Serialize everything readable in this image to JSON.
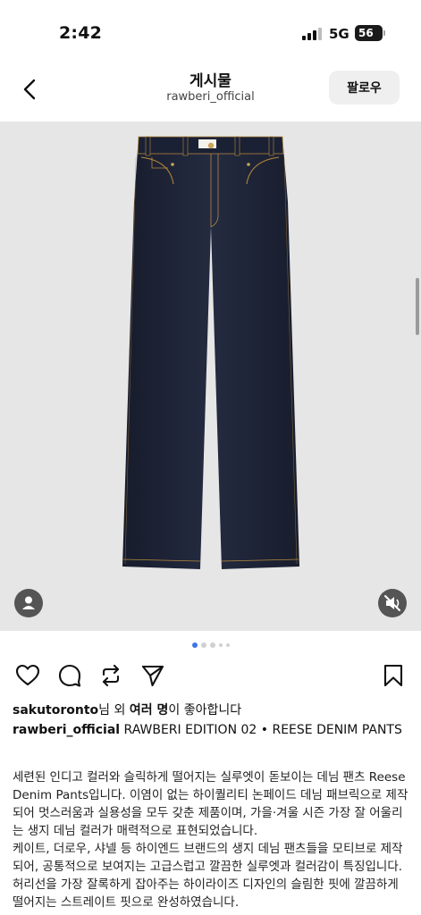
{
  "status_bar": {
    "time": "2:42",
    "network": "5G",
    "battery_label": "56"
  },
  "header": {
    "title": "게시물",
    "subtitle": "rawberi_official",
    "follow_label": "팔로우"
  },
  "post": {
    "image_subject": "dark indigo denim pants",
    "carousel": {
      "total": 5,
      "active_index": 0
    }
  },
  "likes": {
    "user": "sakutoronto",
    "mid": "님 외 ",
    "others": "여러 명",
    "suffix": "이 좋아합니다"
  },
  "caption": {
    "username": "rawberi_official",
    "headline": "RAWBERI EDITION 02 • REESE DENIM PANTS",
    "paragraph1": "세련된 인디고 컬러와 슬릭하게 떨어지는 실루엣이 돋보이는 데님 팬츠 Reese Denim Pants입니다. 이염이 없는 하이퀄리티 논페이드 데님 패브릭으로 제작되어 멋스러움과 실용성을 모두 갖춘 제품이며, 가을·겨울 시즌 가장 잘 어울리는 생지 데님 컬러가 매력적으로 표현되었습니다.",
    "paragraph2": "케이트, 더로우, 샤넬 등 하이엔드 브랜드의 생지 데님 팬츠들을 모티브로 제작되어, 공통적으로 보여지는 고급스럽고 깔끔한 실루엣과 컬러감이 특징입니다. 허리선을 가장 잘록하게 잡아주는 하이라이즈 디자인의 슬림한 핏에 깔끔하게 떨어지는 스트레이트 핏으로 완성하였습니다."
  },
  "icons": {
    "back": "chevron-left-icon",
    "like": "heart-icon",
    "comment": "comment-bubble-icon",
    "repost": "repost-icon",
    "share": "paper-plane-icon",
    "save": "bookmark-icon",
    "user_tag": "person-icon",
    "mute": "speaker-muted-icon"
  },
  "colors": {
    "accent": "#3f73e8",
    "denim": "#1e2436",
    "stitch": "#b88a3e",
    "image_bg": "#e6e6e6"
  }
}
